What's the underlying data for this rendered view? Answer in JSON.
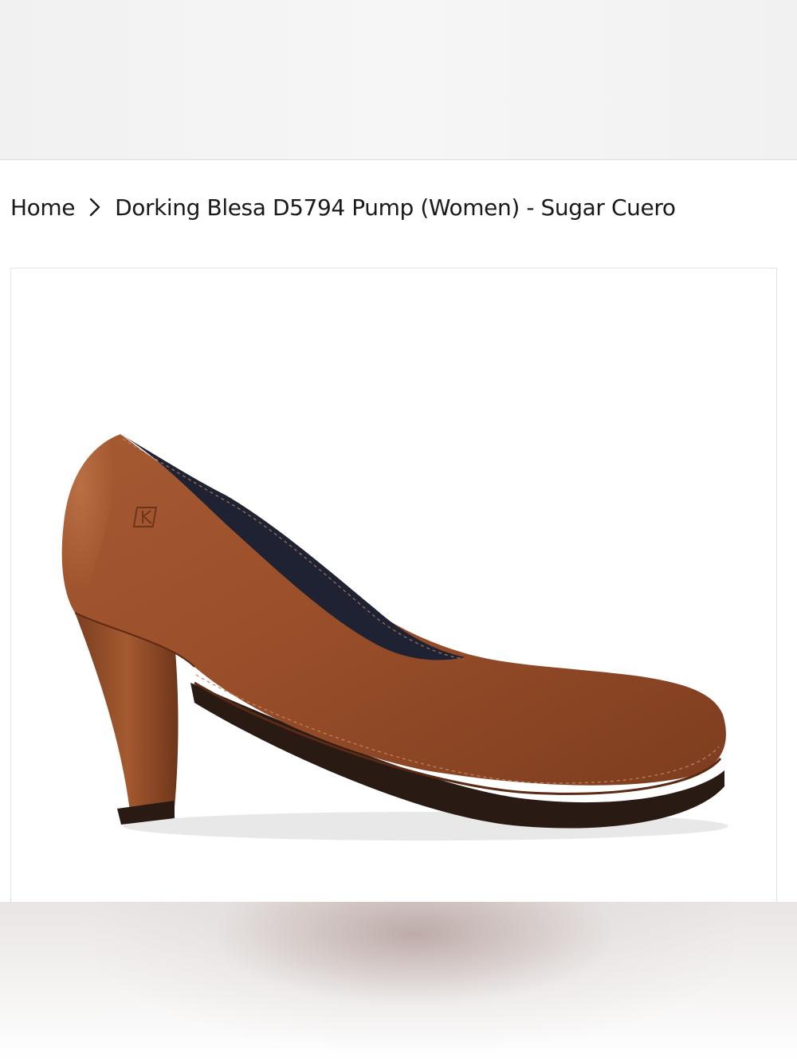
{
  "breadcrumb": {
    "home_label": "Home",
    "separator_icon": "chevron-right-icon",
    "current_label": "Dorking Blesa D5794 Pump (Women) - Sugar Cuero"
  },
  "product_image": {
    "alt": "Dorking Blesa D5794 Pump (Women) - Sugar Cuero",
    "colors": {
      "leather": "#9a4f2a",
      "leather_dark": "#6e341a",
      "lining": "#1f2233",
      "sole": "#2a1a14"
    }
  }
}
